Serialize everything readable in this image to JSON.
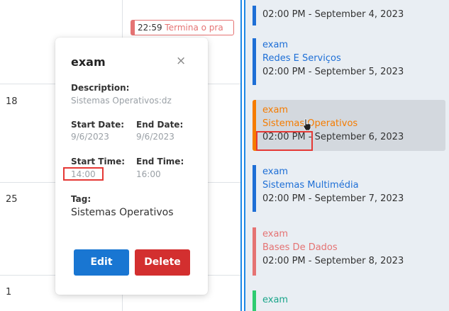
{
  "calendar": {
    "day_numbers": [
      {
        "label": "18"
      },
      {
        "label": "25"
      },
      {
        "label": "1"
      }
    ],
    "event_preview": {
      "time": "22:59",
      "text": "Termina o pra"
    }
  },
  "popover": {
    "title": "exam",
    "close_icon": "×",
    "description_label": "Description:",
    "description_value": "Sistemas Operativos:dz",
    "start_date_label": "Start Date:",
    "start_date_value": "9/6/2023",
    "end_date_label": "End Date:",
    "end_date_value": "9/6/2023",
    "start_time_label": "Start Time:",
    "start_time_value": "14:00",
    "end_time_label": "End Time:",
    "end_time_value": "16:00",
    "tag_label": "Tag:",
    "tag_value": "Sistemas Operativos",
    "edit_label": "Edit",
    "delete_label": "Delete"
  },
  "event_list": [
    {
      "label": "",
      "subject": "",
      "time": "02:00 PM - September 4, 2023",
      "color": "#1e6fd6",
      "text_color": "#1e6fd6"
    },
    {
      "label": "exam",
      "subject": "Redes E Serviços",
      "time": "02:00 PM - September 5, 2023",
      "color": "#1e6fd6",
      "text_color": "#1e6fd6"
    },
    {
      "label": "exam",
      "subject": "Sistemas Operativos",
      "time": "02:00 PM - September 6, 2023",
      "color": "#f57c00",
      "text_color": "#f57c00"
    },
    {
      "label": "exam",
      "subject": "Sistemas Multimédia",
      "time": "02:00 PM - September 7, 2023",
      "color": "#1e6fd6",
      "text_color": "#1e6fd6"
    },
    {
      "label": "exam",
      "subject": "Bases De Dados",
      "time": "02:00 PM - September 8, 2023",
      "color": "#e57373",
      "text_color": "#e57373"
    },
    {
      "label": "exam",
      "subject": "",
      "time": "",
      "color": "#2ecc71",
      "text_color": "#1aa58a"
    }
  ],
  "colors": {
    "accent_blue": "#1976d2",
    "danger_red": "#d32f2f",
    "annotation_red": "#e53935",
    "list_bg": "#e9eef3"
  }
}
